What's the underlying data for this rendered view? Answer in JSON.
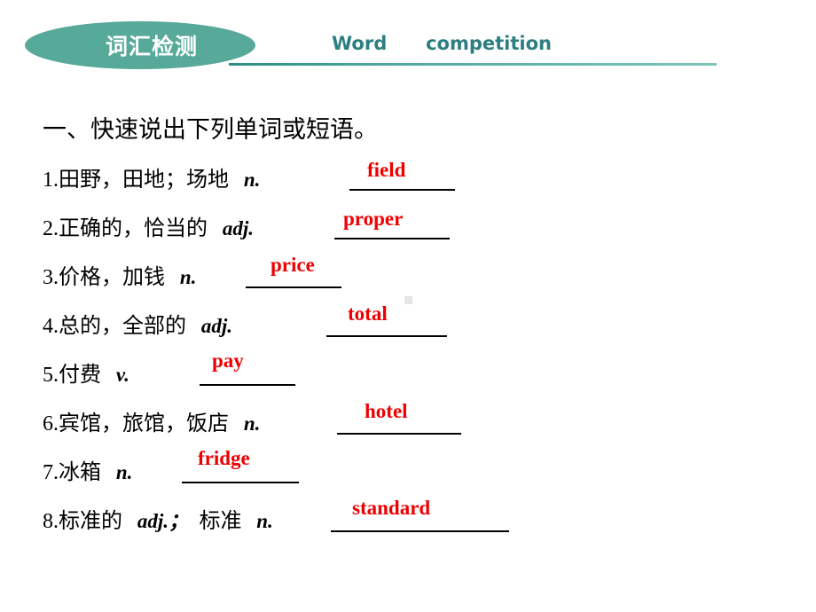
{
  "header": {
    "badge_label": "词汇检测",
    "title": "Word      competition",
    "accent_color": "#57a99a",
    "title_color": "#2d7e80"
  },
  "body": {
    "section_heading": "一、快速说出下列单词或短语。",
    "answer_color": "#ef0000",
    "items": [
      {
        "number": "1.",
        "prompt": "田野，田地；场地",
        "pos": "n.",
        "answer": "field"
      },
      {
        "number": "2.",
        "prompt": "正确的，恰当的",
        "pos": "adj.",
        "answer": "proper"
      },
      {
        "number": "3.",
        "prompt": "价格，加钱",
        "pos": "n.",
        "answer": "price"
      },
      {
        "number": "4.",
        "prompt": "总的，全部的",
        "pos": "adj.",
        "answer": "total"
      },
      {
        "number": "5.",
        "prompt": "付费",
        "pos": "v.",
        "answer": "pay"
      },
      {
        "number": "6.",
        "prompt": "宾馆，旅馆，饭店",
        "pos": "n.",
        "answer": "hotel"
      },
      {
        "number": "7.",
        "prompt": "冰箱",
        "pos": "n.",
        "answer": "fridge"
      },
      {
        "number": "8.",
        "prompt": "标准的",
        "pos": "adj.；",
        "answer": "standard",
        "pos2_prompt": "标准",
        "pos2": "n."
      }
    ]
  }
}
